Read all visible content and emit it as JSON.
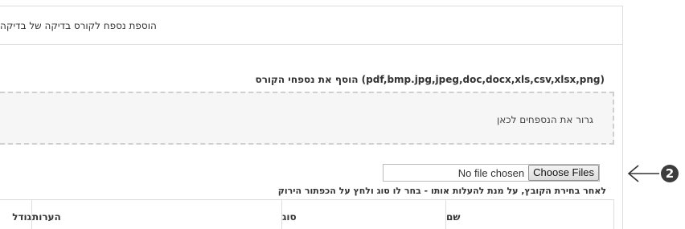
{
  "panel": {
    "heading": "הוספת נספח לקורס בדיקה של בדיקה",
    "section_title": "הוסף את נספחי הקורס (pdf,bmp.jpg,jpeg,doc,docx,xls,csv,xlsx,png)",
    "dropzone_text": "גרור את הנספחים לכאן"
  },
  "file_input": {
    "button_label": "Choose Files",
    "status": "No file chosen"
  },
  "instruction": "לאחר בחירת הקובץ, על מנת להעלות אותו - בחר לו סוג ולחץ על הכפתור הירוק",
  "table": {
    "headers": [
      "שם",
      "סוג",
      "הערות",
      "גודל"
    ]
  },
  "callout": {
    "number": "2"
  },
  "colors": {
    "border": "#dddddd",
    "dropzone_bg": "#f6f6f6",
    "badge": "#3c3c3c"
  }
}
